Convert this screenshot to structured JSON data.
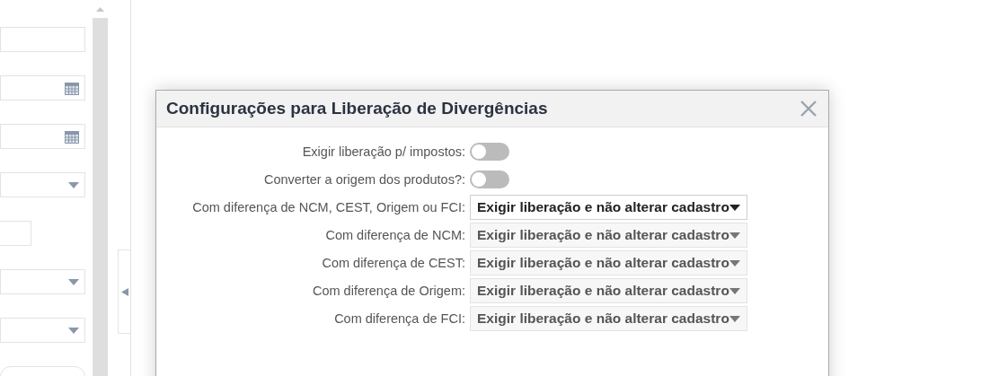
{
  "background_form": {
    "fields": [
      {
        "kind": "text"
      },
      {
        "kind": "date"
      },
      {
        "kind": "date"
      },
      {
        "kind": "select"
      },
      {
        "kind": "short"
      },
      {
        "kind": "select"
      },
      {
        "kind": "select"
      },
      {
        "kind": "button"
      }
    ]
  },
  "dialog": {
    "title": "Configurações para Liberação de Divergências",
    "rows": [
      {
        "kind": "toggle",
        "label": "Exigir liberação p/ impostos:",
        "on": false
      },
      {
        "kind": "toggle",
        "label": "Converter a origem dos produtos?:",
        "on": false
      },
      {
        "kind": "select",
        "label": "Com diferença de NCM, CEST, Origem ou FCI:",
        "value": "Exigir liberação e não alterar cadastro",
        "disabled": false
      },
      {
        "kind": "select",
        "label": "Com diferença de NCM:",
        "value": "Exigir liberação e não alterar cadastro",
        "disabled": true
      },
      {
        "kind": "select",
        "label": "Com diferença de CEST:",
        "value": "Exigir liberação e não alterar cadastro",
        "disabled": true
      },
      {
        "kind": "select",
        "label": "Com diferença de Origem:",
        "value": "Exigir liberação e não alterar cadastro",
        "disabled": true
      },
      {
        "kind": "select",
        "label": "Com diferença de FCI:",
        "value": "Exigir liberação e não alterar cadastro",
        "disabled": true
      }
    ]
  }
}
